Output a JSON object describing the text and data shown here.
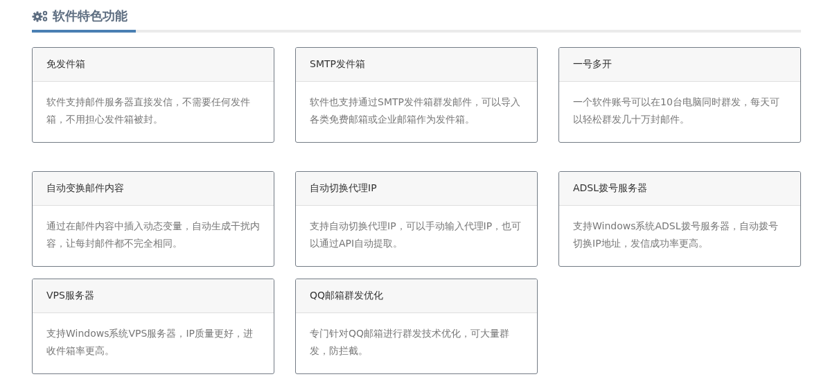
{
  "section": {
    "title": "软件特色功能"
  },
  "cards": [
    {
      "title": "免发件箱",
      "text": "软件支持邮件服务器直接发信，不需要任何发件箱，不用担心发件箱被封。"
    },
    {
      "title": "SMTP发件箱",
      "text": "软件也支持通过SMTP发件箱群发邮件，可以导入各类免费邮箱或企业邮箱作为发件箱。"
    },
    {
      "title": "一号多开",
      "text": "一个软件账号可以在10台电脑同时群发，每天可以轻松群发几十万封邮件。"
    },
    {
      "title": "自动变换邮件内容",
      "text": "通过在邮件内容中插入动态变量，自动生成干扰内容，让每封邮件都不完全相同。"
    },
    {
      "title": "自动切换代理IP",
      "text": "支持自动切换代理IP，可以手动输入代理IP，也可以通过API自动提取。"
    },
    {
      "title": "ADSL拨号服务器",
      "text": "支持Windows系统ADSL拨号服务器，自动拨号切换IP地址，发信成功率更高。"
    },
    {
      "title": "VPS服务器",
      "text": "支持Windows系统VPS服务器，IP质量更好，进收件箱率更高。"
    },
    {
      "title": "QQ邮箱群发优化",
      "text": "专门针对QQ邮箱进行群发技术优化，可大量群发，防拦截。"
    }
  ]
}
